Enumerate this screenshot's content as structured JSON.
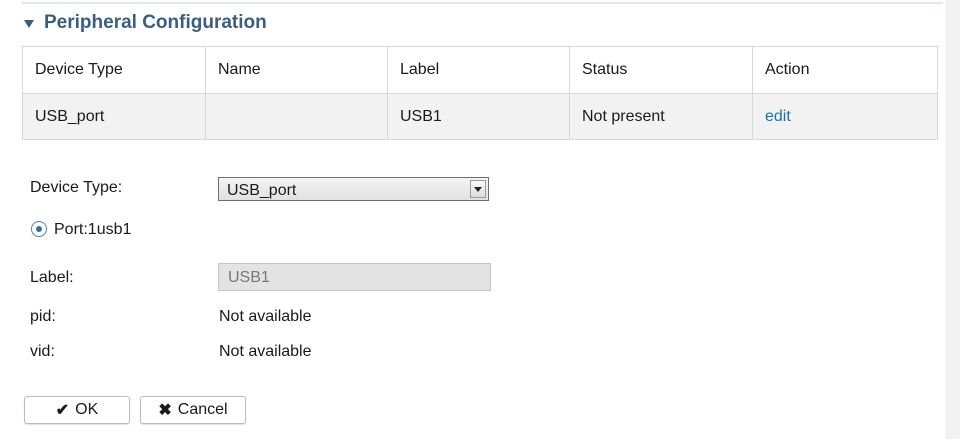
{
  "section": {
    "title": "Peripheral Configuration",
    "caret_icon": "caret-down-icon"
  },
  "table": {
    "columns": [
      "Device Type",
      "Name",
      "Label",
      "Status",
      "Action"
    ],
    "rows": [
      {
        "device_type": "USB_port",
        "name": "",
        "label": "USB1",
        "status": "Not present",
        "action": "edit"
      }
    ]
  },
  "form": {
    "device_type_label": "Device Type:",
    "device_type_value": "USB_port",
    "port_radio_label": "Port:1usb1",
    "port_radio_checked": true,
    "label_label": "Label:",
    "label_value": "USB1",
    "pid_label": "pid:",
    "pid_value": "Not available",
    "vid_label": "vid:",
    "vid_value": "Not available"
  },
  "buttons": {
    "ok_label": "OK",
    "ok_icon": "checkmark-icon",
    "cancel_label": "Cancel",
    "cancel_icon": "x-icon"
  },
  "colors": {
    "title": "#3d5e7a",
    "link": "#1f6fa3",
    "row_background": "#f2f2f2"
  }
}
